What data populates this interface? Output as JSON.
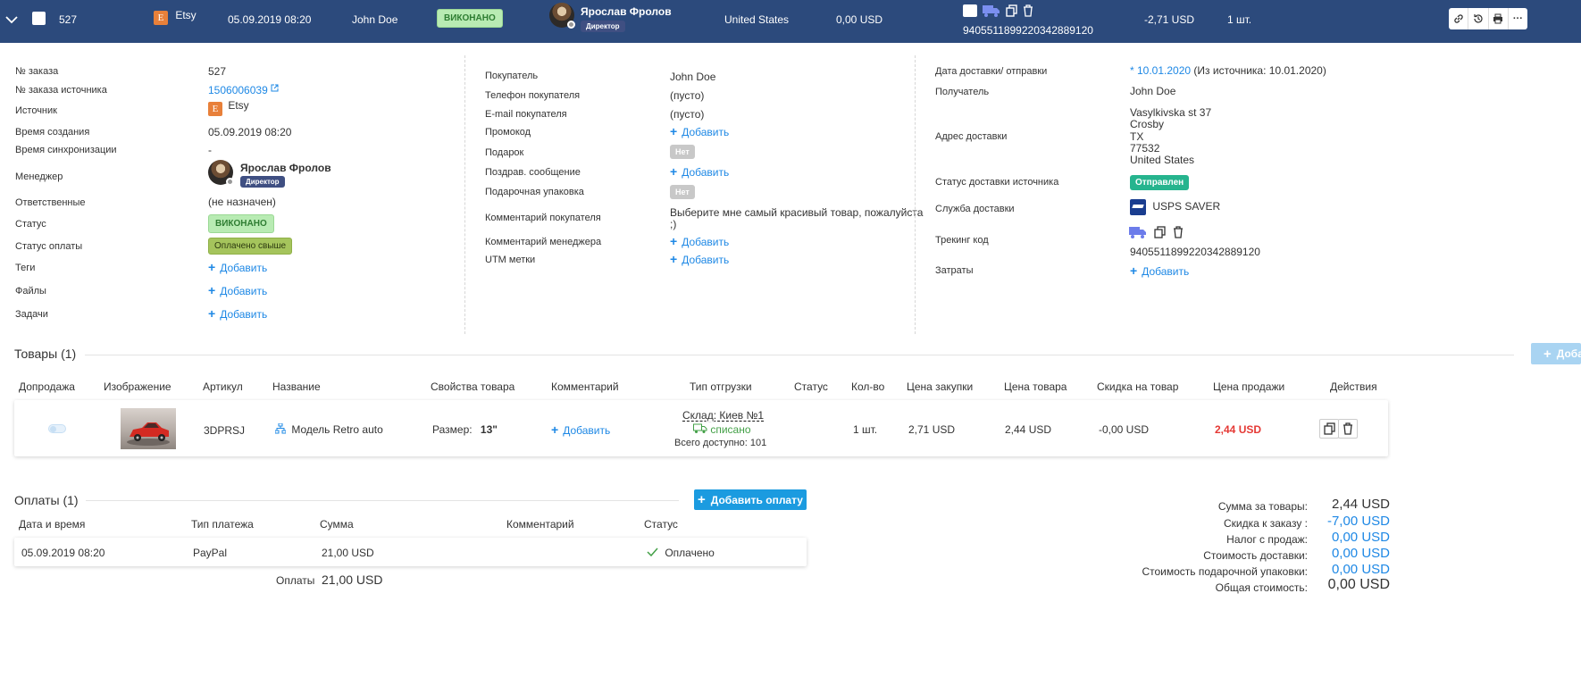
{
  "header": {
    "order_number": "527",
    "source": "Etsy",
    "source_icon_letter": "E",
    "created": "05.09.2019 08:20",
    "customer": "John Doe",
    "status": "ВИКОНАНО",
    "manager_name": "Ярослав Фролов",
    "manager_role": "Директор",
    "country": "United States",
    "amount": "0,00 USD",
    "tracking": "9405511899220342889120",
    "cost": "-2,71 USD",
    "quantity": "1 шт."
  },
  "left_panel": {
    "order_number_label": "№ заказа",
    "order_number": "527",
    "source_order_label": "№ заказа источника",
    "source_order": "1506006039",
    "source_label": "Источник",
    "source": "Etsy",
    "created_label": "Время создания",
    "created": "05.09.2019 08:20",
    "sync_label": "Время синхронизации",
    "sync": "-",
    "manager_label": "Менеджер",
    "manager_name": "Ярослав Фролов",
    "manager_role": "Директор",
    "responsible_label": "Ответственные",
    "responsible": "(не назначен)",
    "status_label": "Статус",
    "status": "ВИКОНАНО",
    "payment_status_label": "Статус оплаты",
    "payment_status": "Оплачено свыше",
    "tags_label": "Теги",
    "files_label": "Файлы",
    "tasks_label": "Задачи",
    "add": "Добавить"
  },
  "middle_panel": {
    "buyer_label": "Покупатель",
    "buyer": "John Doe",
    "phone_label": "Телефон покупателя",
    "phone": "(пусто)",
    "email_label": "E-mail покупателя",
    "email": "(пусто)",
    "promo_label": "Промокод",
    "gift_label": "Подарок",
    "gift": "Нет",
    "greeting_label": "Поздрав. сообщение",
    "wrapping_label": "Подарочная упаковка",
    "wrapping": "Нет",
    "buyer_comment_label": "Комментарий покупателя",
    "buyer_comment_1": "Выберите мне самый красивый товар, пожалуйста",
    "buyer_comment_2": ";)",
    "manager_comment_label": "Комментарий менеджера",
    "utm_label": "UTM метки",
    "add": "Добавить"
  },
  "right_panel": {
    "delivery_date_label": "Дата доставки/ отправки",
    "delivery_date": "* 10.01.2020",
    "delivery_date_source": "(Из источника: 10.01.2020)",
    "recipient_label": "Получатель",
    "recipient": "John Doe",
    "address_label": "Адрес доставки",
    "address_lines": [
      "Vasylkivska st 37",
      "Crosby",
      "TX",
      "77532",
      "United States"
    ],
    "source_delivery_status_label": "Статус доставки источника",
    "source_delivery_status": "Отправлен",
    "delivery_service_label": "Служба доставки",
    "delivery_service": "USPS SAVER",
    "tracking_label": "Трекинг код",
    "tracking": "9405511899220342889120",
    "costs_label": "Затраты",
    "add": "Добавить"
  },
  "goods": {
    "title": "Товары",
    "count": "(1)",
    "add_button": "Добавить товар",
    "columns": [
      "Допродажа",
      "Изображение",
      "Артикул",
      "Название",
      "Свойства товара",
      "Комментарий",
      "Тип отгрузки",
      "Статус",
      "Кол-во",
      "Цена закупки",
      "Цена товара",
      "Скидка на товар",
      "Цена продажи",
      "Действия"
    ],
    "row": {
      "sku": "3DPRSJ",
      "name": "Модель Retro auto",
      "prop_label": "Размер:",
      "prop_value": "13\"",
      "comment_add": "Добавить",
      "warehouse": "Склад: Киев №1",
      "written_off": "списано",
      "available": "Всего доступно: 101",
      "qty": "1 шт.",
      "purchase_price": "2,71 USD",
      "item_price": "2,44 USD",
      "discount": "-0,00 USD",
      "sale_price": "2,44 USD"
    }
  },
  "payments": {
    "title": "Оплаты",
    "count": "(1)",
    "add_button": "Добавить оплату",
    "columns": [
      "Дата и время",
      "Тип платежа",
      "Сумма",
      "Комментарий",
      "Статус"
    ],
    "row": {
      "date": "05.09.2019 08:20",
      "type": "PayPal",
      "amount": "21,00 USD",
      "status": "Оплачено"
    },
    "total_label": "Оплаты",
    "total": "21,00 USD"
  },
  "summary": {
    "goods_label": "Сумма за товары:",
    "goods": "2,44 USD",
    "discount_label": "Скидка к заказу :",
    "discount": "-7,00 USD",
    "tax_label": "Налог с продаж:",
    "tax": "0,00 USD",
    "delivery_label": "Стоимость доставки:",
    "delivery": "0,00 USD",
    "wrapping_label": "Стоимость подарочной упаковки:",
    "wrapping": "0,00 USD",
    "total_label": "Общая стоимость:",
    "total": "0,00 USD"
  },
  "colors": {
    "header_bg": "#2c4a7c",
    "link": "#1e88e5",
    "primary_button": "#1b9be0",
    "sale_price": "#e53935",
    "status_green": "#b8ebb3"
  }
}
